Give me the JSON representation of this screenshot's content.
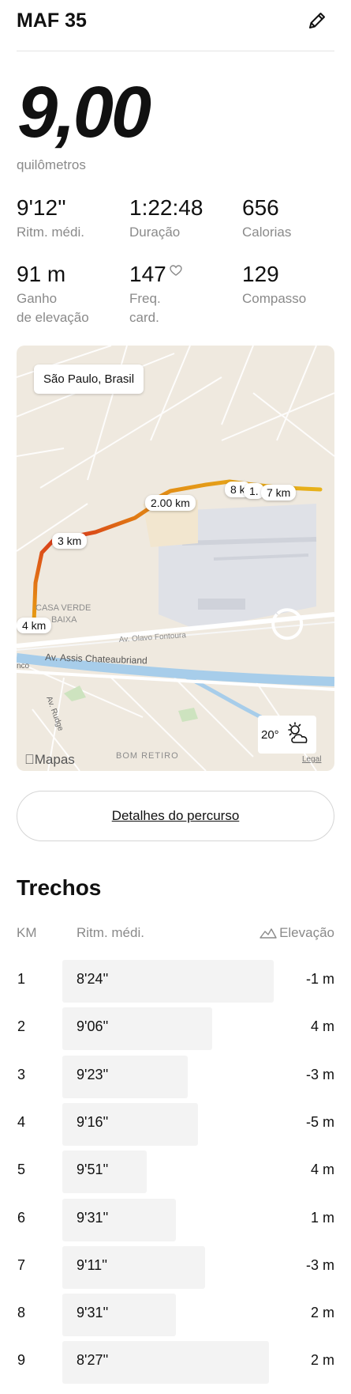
{
  "header": {
    "title": "MAF 35"
  },
  "summary": {
    "distance": "9,00",
    "distance_unit": "quilômetros"
  },
  "stats": {
    "pace": {
      "value": "9'12''",
      "label": "Ritm. médi."
    },
    "duration": {
      "value": "1:22:48",
      "label": "Duração"
    },
    "calories": {
      "value": "656",
      "label": "Calorias"
    },
    "elevation": {
      "value": "91 m",
      "label_line1": "Ganho",
      "label_line2": "de elevação"
    },
    "heart": {
      "value": "147",
      "label_line1": "Freq.",
      "label_line2": "card."
    },
    "cadence": {
      "value": "129",
      "label": "Compasso"
    }
  },
  "map": {
    "location": "São Paulo, Brasil",
    "km_markers": [
      "2.00 km",
      "3 km",
      "4 km",
      "8 k",
      "1.",
      "7 km"
    ],
    "street_labels": [
      "CASA VERDE",
      "BAIXA",
      "Av. Olavo Fontoura",
      "Av. Assis Chateaubriand",
      "nco",
      "Av. Rudge",
      "BOM RETIRO"
    ],
    "weather_temp": "20°",
    "weather_icon": "partly-cloudy-icon",
    "maps_brand": "Mapas",
    "legal": "Legal",
    "route_color_start": "#e8a013",
    "route_color_mid": "#d8361a"
  },
  "route_details_button": "Detalhes do percurso",
  "splits": {
    "title": "Trechos",
    "col_km": "KM",
    "col_pace": "Ritm. médi.",
    "col_elevation": "Elevação",
    "rows": [
      {
        "km": "1",
        "pace": "8'24''",
        "elevation": "-1 m",
        "pace_seconds": 504
      },
      {
        "km": "2",
        "pace": "9'06''",
        "elevation": "4 m",
        "pace_seconds": 546
      },
      {
        "km": "3",
        "pace": "9'23''",
        "elevation": "-3 m",
        "pace_seconds": 563
      },
      {
        "km": "4",
        "pace": "9'16''",
        "elevation": "-5 m",
        "pace_seconds": 556
      },
      {
        "km": "5",
        "pace": "9'51''",
        "elevation": "4 m",
        "pace_seconds": 591
      },
      {
        "km": "6",
        "pace": "9'31''",
        "elevation": "1 m",
        "pace_seconds": 571
      },
      {
        "km": "7",
        "pace": "9'11''",
        "elevation": "-3 m",
        "pace_seconds": 551
      },
      {
        "km": "8",
        "pace": "9'31''",
        "elevation": "2 m",
        "pace_seconds": 571
      },
      {
        "km": "9",
        "pace": "8'27''",
        "elevation": "2 m",
        "pace_seconds": 507
      }
    ]
  }
}
